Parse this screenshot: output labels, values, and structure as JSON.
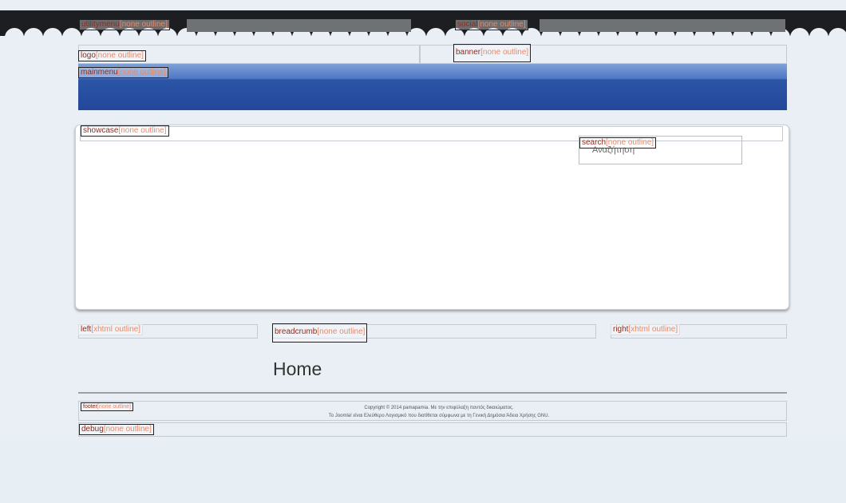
{
  "positions": {
    "utilitymenu": {
      "name": "utilitymenu",
      "style": "[none outline]"
    },
    "social": {
      "name": "social",
      "style": "[none outline]"
    },
    "logo": {
      "name": "logo",
      "style": "[none outline]"
    },
    "banner": {
      "name": "banner",
      "style": "[none outline]"
    },
    "mainmenu": {
      "name": "mainmenu",
      "style": "[none outline]"
    },
    "showcase": {
      "name": "showcase",
      "style": "[none outline]"
    },
    "search": {
      "name": "search",
      "style": "[none outline]"
    },
    "left": {
      "name": "left",
      "style": "[xhtml outline]"
    },
    "breadcrumb": {
      "name": "breadcrumb",
      "style": "[none outline]"
    },
    "right": {
      "name": "right",
      "style": "[xhtml outline]"
    },
    "footer": {
      "name": "footer",
      "style": "[none outline]"
    },
    "debug": {
      "name": "debug",
      "style": "[none outline]"
    }
  },
  "search": {
    "placeholder": "Αναζήτηση"
  },
  "content": {
    "title": "Home"
  },
  "footer": {
    "copyright": "Copyright © 2014 pamapamia. Με την επιφύλαξη παντός δικαιώματος.",
    "license": "Το Joomla! είναι Ελεύθερο Λογισμικό που διατίθεται σύμφωνα με τη Γενική Δημόσια Άδεια Χρήσης GNU."
  },
  "colors": {
    "background": "#e9eff4",
    "topbar": "#1d1e22",
    "mainmenu": "#23479b",
    "label_name": "#8b2c1e",
    "label_style": "#e58a6a"
  }
}
